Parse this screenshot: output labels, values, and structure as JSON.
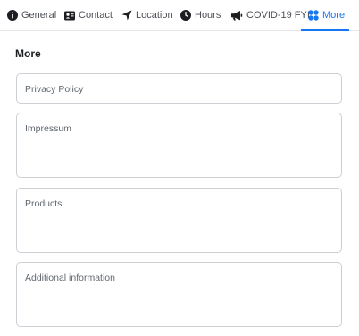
{
  "tabs": [
    {
      "label": "General",
      "icon": "info-icon"
    },
    {
      "label": "Contact",
      "icon": "contact-card-icon"
    },
    {
      "label": "Location",
      "icon": "location-arrow-icon"
    },
    {
      "label": "Hours",
      "icon": "clock-icon"
    },
    {
      "label": "COVID-19 FYI",
      "icon": "megaphone-icon"
    },
    {
      "label": "More",
      "icon": "grid-dots-icon",
      "active": true
    }
  ],
  "section": {
    "title": "More"
  },
  "fields": [
    {
      "placeholder": "Privacy Policy"
    },
    {
      "placeholder": "Impressum"
    },
    {
      "placeholder": "Products"
    },
    {
      "placeholder": "Additional information"
    }
  ],
  "colors": {
    "accent": "#1877f2",
    "border": "#ccd0d5",
    "text": "#1c1e21"
  }
}
